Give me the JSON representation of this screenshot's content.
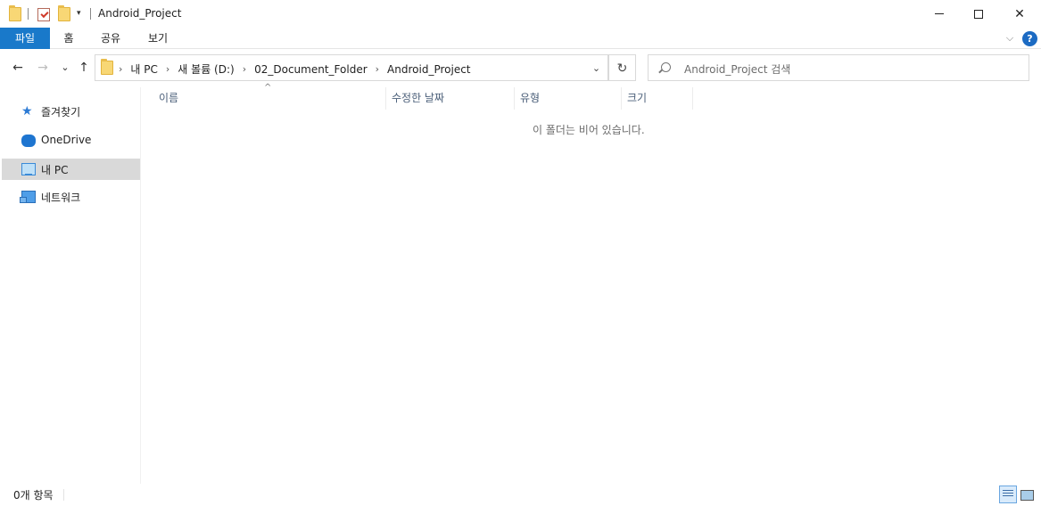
{
  "window": {
    "title": "Android_Project",
    "minimize_icon": "minimize-icon",
    "maximize_icon": "maximize-icon",
    "close_symbol": "✕"
  },
  "quick_access": {
    "dropdown_symbol": "▾"
  },
  "ribbon": {
    "tabs": [
      "파일",
      "홈",
      "공유",
      "보기"
    ],
    "expand_symbol": "⌵",
    "help_symbol": "?"
  },
  "nav": {
    "back_symbol": "←",
    "forward_symbol": "→",
    "recent_symbol": "⌄",
    "up_symbol": "↑",
    "refresh_symbol": "↻",
    "dropdown_symbol": "⌄"
  },
  "address": {
    "crumbs": [
      "내 PC",
      "새 볼륨 (D:)",
      "02_Document_Folder",
      "Android_Project"
    ],
    "sep": "›"
  },
  "search": {
    "placeholder": "Android_Project 검색"
  },
  "navpane": {
    "items": [
      {
        "label": "즐겨찾기",
        "icon": "star-icon"
      },
      {
        "label": "OneDrive",
        "icon": "onedrive-cloud-icon"
      },
      {
        "label": "내 PC",
        "icon": "computer-icon",
        "selected": true
      },
      {
        "label": "네트워크",
        "icon": "network-icon"
      }
    ]
  },
  "columns": [
    "이름",
    "수정한 날짜",
    "유형",
    "크기"
  ],
  "sort_caret": "^",
  "content": {
    "empty_message": "이 폴더는 비어 있습니다."
  },
  "statusbar": {
    "item_count": "0개 항목"
  },
  "colors": {
    "file_tab": "#1979ca",
    "selected_nav": "#d9d9d9",
    "folder": "#f8d775",
    "help": "#1c6bc3"
  }
}
